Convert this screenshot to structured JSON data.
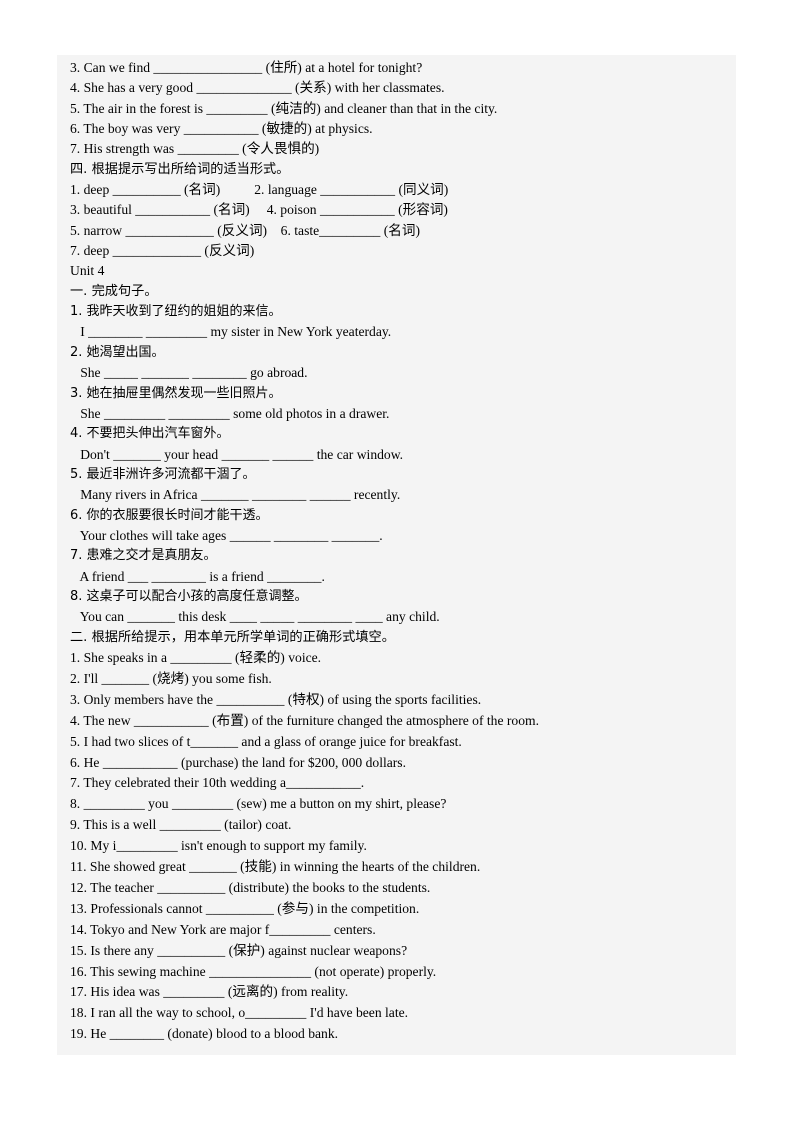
{
  "document": {
    "background_color": "#ffffff",
    "sheet_color": "#f4f4f4",
    "text_color": "#000000"
  },
  "lines": [
    {
      "id": "u3-3-3",
      "text": "3. Can we find ________________ (住所) at a hotel for tonight?"
    },
    {
      "id": "u3-3-4",
      "text": "4. She has a very good ______________ (关系) with her classmates."
    },
    {
      "id": "u3-3-5",
      "text": "5. The air in the forest is _________ (纯洁的) and cleaner than that in the city."
    },
    {
      "id": "u3-3-6",
      "text": "6. The boy was very ___________ (敏捷的) at physics."
    },
    {
      "id": "u3-3-7",
      "text": "7. His strength was _________ (令人畏惧的)"
    },
    {
      "id": "u3-sec4-head",
      "text": "四. 根据提示写出所给词的适当形式。"
    },
    {
      "id": "u3-4-1",
      "text": "1. deep __________ (名词)          2. language ___________ (同义词)"
    },
    {
      "id": "u3-4-3",
      "text": "3. beautiful ___________ (名词)     4. poison ___________ (形容词)"
    },
    {
      "id": "u3-4-5",
      "text": "5. narrow _____________ (反义词)    6. taste_________ (名词)"
    },
    {
      "id": "u3-4-7",
      "text": "7. deep _____________ (反义词)"
    },
    {
      "id": "unit4-title",
      "text": "Unit 4"
    },
    {
      "id": "u4-sec1-head",
      "text": "一. 完成句子。"
    },
    {
      "id": "u4-1-1-cn",
      "text": "1. 我昨天收到了纽约的姐姐的来信。"
    },
    {
      "id": "u4-1-1-en",
      "text": "   I ________ _________ my sister in New York yeaterday."
    },
    {
      "id": "u4-1-2-cn",
      "text": "2. 她渴望出国。"
    },
    {
      "id": "u4-1-2-en",
      "text": "   She _____ _______ ________ go abroad."
    },
    {
      "id": "u4-1-3-cn",
      "text": "3. 她在抽屉里偶然发现一些旧照片。"
    },
    {
      "id": "u4-1-3-en",
      "text": "   She _________ _________ some old photos in a drawer."
    },
    {
      "id": "u4-1-4-cn",
      "text": "4. 不要把头伸出汽车窗外。"
    },
    {
      "id": "u4-1-4-en",
      "text": "   Don't _______ your head _______ ______ the car window."
    },
    {
      "id": "u4-1-5-cn",
      "text": "5. 最近非洲许多河流都干涸了。"
    },
    {
      "id": "u4-1-5-en",
      "text": "   Many rivers in Africa _______ ________ ______ recently."
    },
    {
      "id": "u4-1-6-cn",
      "text": "6. 你的衣服要很长时间才能干透。"
    },
    {
      "id": "u4-1-6-en",
      "text": "   Your clothes will take ages ______ ________ _______."
    },
    {
      "id": "u4-1-7-cn",
      "text": "7. 患难之交才是真朋友。"
    },
    {
      "id": "u4-1-7-en",
      "text": "   A friend ___ ________ is a friend ________."
    },
    {
      "id": "u4-1-8-cn",
      "text": "8. 这桌子可以配合小孩的高度任意调整。"
    },
    {
      "id": "u4-1-8-en",
      "text": "   You can _______ this desk ____ _____ ________ ____ any child."
    },
    {
      "id": "u4-sec2-head",
      "text": "二. 根据所给提示，用本单元所学单词的正确形式填空。"
    },
    {
      "id": "u4-2-1",
      "text": "1. She speaks in a _________ (轻柔的) voice."
    },
    {
      "id": "u4-2-2",
      "text": "2. I'll _______ (烧烤) you some fish."
    },
    {
      "id": "u4-2-3",
      "text": "3. Only members have the __________ (特权) of using the sports facilities."
    },
    {
      "id": "u4-2-4",
      "text": "4. The new ___________ (布置) of the furniture changed the atmosphere of the room."
    },
    {
      "id": "u4-2-5",
      "text": "5. I had two slices of t_______ and a glass of orange juice for breakfast."
    },
    {
      "id": "u4-2-6",
      "text": "6. He ___________ (purchase) the land for $200, 000 dollars."
    },
    {
      "id": "u4-2-7",
      "text": "7. They celebrated their 10th wedding a___________."
    },
    {
      "id": "u4-2-8",
      "text": "8. _________ you _________ (sew) me a button on my shirt, please?"
    },
    {
      "id": "u4-2-9",
      "text": "9. This is a well _________ (tailor) coat."
    },
    {
      "id": "u4-2-10",
      "text": "10. My i_________ isn't enough to support my family."
    },
    {
      "id": "u4-2-11",
      "text": "11. She showed great _______ (技能) in winning the hearts of the children."
    },
    {
      "id": "u4-2-12",
      "text": "12. The teacher __________ (distribute) the books to the students."
    },
    {
      "id": "u4-2-13",
      "text": "13. Professionals cannot __________ (参与) in the competition."
    },
    {
      "id": "u4-2-14",
      "text": "14. Tokyo and New York are major f_________ centers."
    },
    {
      "id": "u4-2-15",
      "text": "15. Is there any __________ (保护) against nuclear weapons?"
    },
    {
      "id": "u4-2-16",
      "text": "16. This sewing machine _______________ (not operate) properly."
    },
    {
      "id": "u4-2-17",
      "text": "17. His idea was _________ (远离的) from reality."
    },
    {
      "id": "u4-2-18",
      "text": "18. I ran all the way to school, o_________ I'd have been late."
    },
    {
      "id": "u4-2-19",
      "text": "19. He ________ (donate) blood to a blood bank."
    }
  ]
}
